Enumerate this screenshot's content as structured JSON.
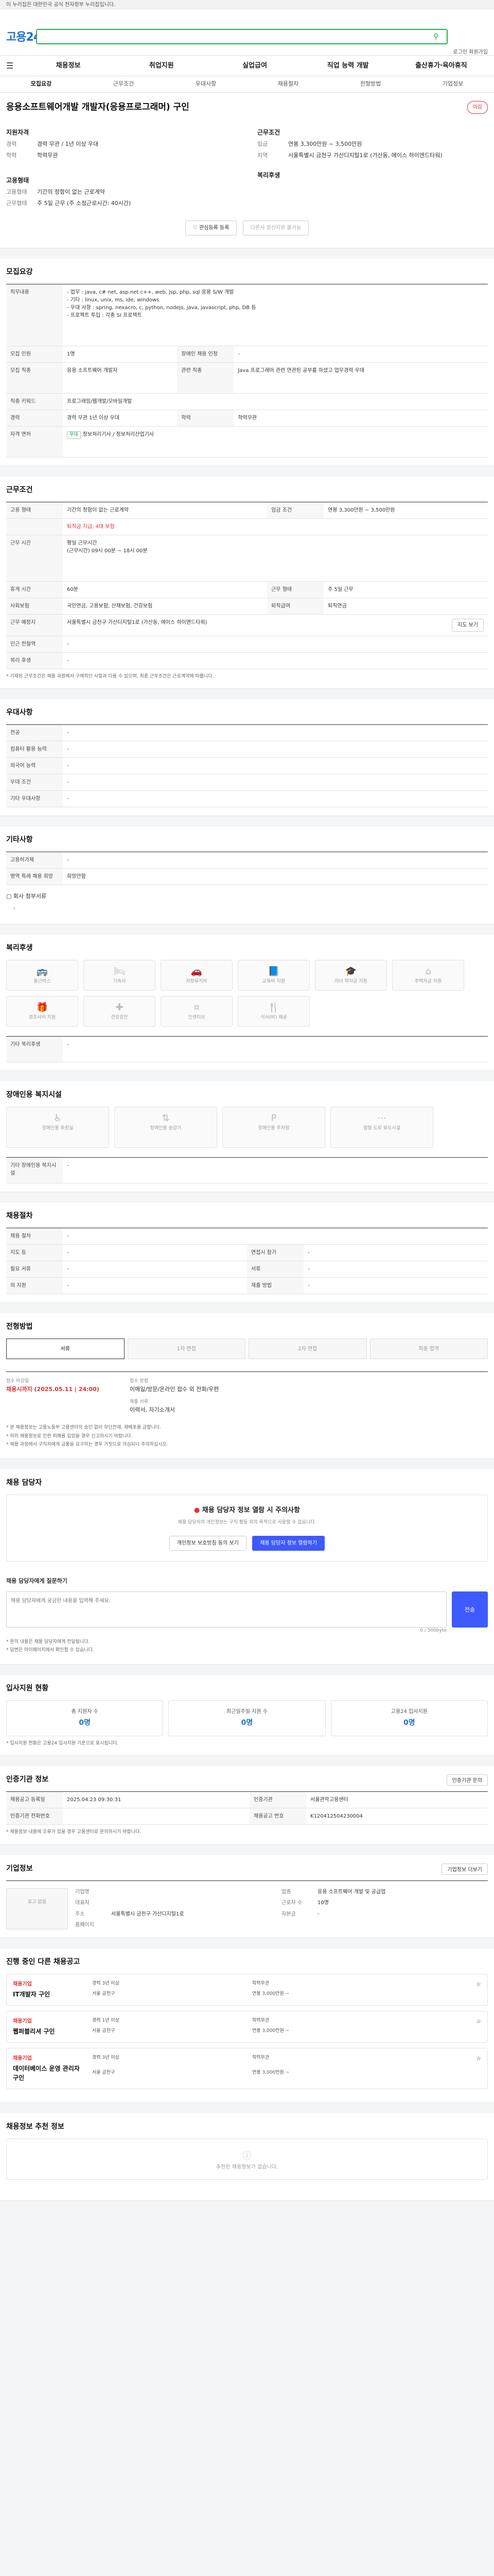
{
  "banner": {
    "text": "이 누리집은 대한민국 공식 전자정부 누리집입니다."
  },
  "header": {
    "logo": "고용24",
    "search_placeholder": "",
    "utils": "로그인 회원가입"
  },
  "nav": [
    "채용정보",
    "취업지원",
    "실업급여",
    "직업 능력 개발",
    "출산휴가·육아휴직"
  ],
  "tabs": [
    "모집요강",
    "근무조건",
    "우대사항",
    "채용절차",
    "전형방법",
    "기업정보"
  ],
  "job": {
    "title": "응용소프트웨어개발 개발자(응용프로그래머) 구인",
    "company": "",
    "badge": "마감",
    "left_title": "지원자격",
    "left_rows": [
      {
        "k": "경력",
        "v": "경력 무관 / 1년 이상 우대"
      },
      {
        "k": "학력",
        "v": "학력무관"
      }
    ],
    "left_title2": "고용형태",
    "left_rows2": [
      {
        "k": "고용형태",
        "v": "기간의 정함이 없는 근로계약"
      },
      {
        "k": "근무형태",
        "v": "주 5일 근무 (주 소정근로시간: 40시간)"
      }
    ],
    "right_title": "근무조건",
    "right_rows": [
      {
        "k": "임금",
        "v": "연봉 3,300만원 ~ 3,500만원"
      },
      {
        "k": "지역",
        "v": "서울특별시 금천구 가산디지털1로 (가산동, 에이스 하이엔드타워)"
      }
    ],
    "right_title2": "복리후생",
    "btn_scrap": "관심등록 등록",
    "btn_apply": "다른사 알선지원 불가능"
  },
  "recruit": {
    "head": "모집요강",
    "duties_label": "직무내용",
    "duties": "- 업무 : java, c# net, asp.net c++, web, jsp, php, sql 응용 S/W 개발\n- 기타 : linux, unix, ms, ide, windows\n- 우대 사항 : spring, nexacro, c, python, nodejs, java, javascript, php, DB 등\n- 프로젝트 투입 : 각종 SI 프로젝트",
    "rows": [
      {
        "k": "모집 인원",
        "v": "1명",
        "k2": "장애인 채용 인정",
        "v2": "-"
      },
      {
        "k": "모집 직종",
        "v": "응용 소프트웨어 개발자",
        "k2": "관련 직종",
        "v2": "Java 프로그래머 관련 연관된 공부를 하셨고 업무경력 우대"
      },
      {
        "k": "직종 키워드",
        "v": "프로그래밍/웹개발/모바일개발",
        "k2": "",
        "v2": ""
      },
      {
        "k": "경력",
        "v": "경력 무관 1년 이상 우대",
        "k2": "학력",
        "v2": "학력무관"
      },
      {
        "k": "자격 면허",
        "v": "정보처리기사 / 정보처리산업기사",
        "k2": "",
        "v2": ""
      }
    ]
  },
  "work": {
    "head": "근무조건",
    "rows": [
      {
        "k": "고용 형태",
        "v": "기간의 정함이 없는 근로계약",
        "k2": "임금 조건",
        "v2": "연봉 3,300만원 ~ 3,500만원"
      },
      {
        "k": "",
        "v": "퇴직금 지급, 4대 보험",
        "k2": "",
        "v2": ""
      },
      {
        "k": "근무 시간",
        "v": "평일 근무시간\n(근무시간) 09시 00분 ~ 18시 00분",
        "k2": "",
        "v2": ""
      },
      {
        "k": "휴게 시간",
        "v": "60분",
        "k2": "근무 형태",
        "v2": "주 5일 근무"
      },
      {
        "k": "사회보험",
        "v": "국민연금, 고용보험, 산재보험, 건강보험",
        "k2": "퇴직급여",
        "v2": "퇴직연금"
      },
      {
        "k": "근무 예정지",
        "v": "서울특별시 금천구 가산디지털1로 (가산동, 에이스 하이엔드타워)",
        "k2": "",
        "v2": ""
      },
      {
        "k": "인근 전철역",
        "v": "-",
        "k2": "",
        "v2": ""
      },
      {
        "k": "복리 후생",
        "v": "-",
        "k2": "",
        "v2": ""
      }
    ],
    "map_btn": "지도 보기",
    "note": "* 기재된 근무조건은 채용 과정에서 구체적인 사항과 다를 수 있으며, 최종 근무조건은 근로계약에 따릅니다."
  },
  "prefer": {
    "head": "우대사항",
    "rows": [
      {
        "k": "전공",
        "v": "-"
      },
      {
        "k": "컴퓨터 활용 능력",
        "v": "-"
      },
      {
        "k": "외국어 능력",
        "v": "-"
      },
      {
        "k": "우대 조건",
        "v": "-"
      },
      {
        "k": "기타 우대사항",
        "v": "-"
      }
    ]
  },
  "etc": {
    "head": "기타사항",
    "rows": [
      {
        "k": "고용허가제",
        "v": "-"
      },
      {
        "k": "병역 특례 채용 희망",
        "v": "희망안함"
      }
    ],
    "attach_label": "회사 첨부서류",
    "attach": "-"
  },
  "welfare": {
    "head": "복리후생",
    "items": [
      "통근버스",
      "기숙사",
      "차량유지비",
      "교육비 지원",
      "자녀 학자금 지원",
      "주택자금 지원",
      "경조사비 지원",
      "건강검진",
      "인센티브",
      "식사(비) 제공"
    ],
    "other_label": "기타 복리후생",
    "other": "-"
  },
  "disability": {
    "head": "장애인용 복지시설",
    "items": [
      "장애인용 화장실",
      "장애인용 승강기",
      "장애인용 주차장",
      "점형 도로 유도시설"
    ],
    "other_label": "기타 장애인용 복지시설",
    "other": "-"
  },
  "process": {
    "head": "채용절차",
    "rows": [
      {
        "k": "채용 절차",
        "v": "-",
        "k2": "",
        "v2": ""
      },
      {
        "k": "지도 등",
        "v": "-",
        "k2": "면접시 참가",
        "v2": "-"
      },
      {
        "k": "필요 서류",
        "v": "-",
        "k2": "서류",
        "v2": "-"
      },
      {
        "k": "외 지원",
        "v": "-",
        "k2": "제출 방법",
        "v2": "-"
      }
    ]
  },
  "selection": {
    "head": "전형방법",
    "steps": [
      "서류",
      "1차 면접",
      "2차 면접",
      "최종 합격"
    ],
    "left_label": "접수 마감일",
    "left_value": "채용시까지 (2025.05.11 | 24:00)",
    "mid_label": "접수 방법",
    "mid_value": "이메일/방문/온라인 접수 외 전화/우편",
    "mid_label2": "제출 서류",
    "mid_value2": "이력서, 자기소개서",
    "notes": [
      "* 본 채용정보는 고용노동부 고용센터의 승인 없이 무단전재, 재배포를 금합니다.",
      "* 허위 채용정보로 인한 피해를 입었을 경우 신고하시기 바랍니다.",
      "* 채용 과정에서 구직자에게 금품을 요구하는 경우 거짓으로 의심되니 주의하십시오."
    ]
  },
  "contact": {
    "head": "채용 담당자",
    "title": "채용 담당자 정보 열람 시 주의사항",
    "desc": "채용 담당자의 개인정보는 구직 활동 외의 목적으로 사용할 수 없습니다.",
    "btn_view": "개인정보 보호방침 동의 보기",
    "btn_open": "채용 담당자 정보 열람하기",
    "qa_title": "채용 담당자에게 질문하기",
    "qa_placeholder": "채용 담당자에게 궁금한 내용을 입력해 주세요.",
    "qa_count": "0 / 500byte",
    "qa_send": "전송",
    "qa_notes": [
      "* 문의 내용은 채용 담당자에게 전달됩니다.",
      "* 답변은 마이페이지에서 확인할 수 있습니다."
    ]
  },
  "stats": {
    "head": "입사지원 현황",
    "cards": [
      {
        "t": "총 지원자 수",
        "v": "0명"
      },
      {
        "t": "최근일주일 지원 수",
        "v": "0명"
      },
      {
        "t": "고용24 입사지원",
        "v": "0명"
      }
    ],
    "note": "* 입사지원 현황은 고용24 입사지원 기준으로 표시됩니다."
  },
  "regist": {
    "head": "인증기관 정보",
    "rows": [
      {
        "k": "채용공고 등록일",
        "v": "2025.04.23 09:30:31",
        "k2": "인증기관",
        "v2": "서울관악고용센터"
      },
      {
        "k": "인증기관 전화번호",
        "v": "",
        "k2": "채용공고 번호",
        "v2": "K120412504230004"
      }
    ],
    "note": "* 채용정보 내용에 오류가 있을 경우 고용센터로 문의하시기 바랍니다.",
    "btn": "인증기관 문의"
  },
  "company_info": {
    "head": "기업정보",
    "logo": "로고 없음",
    "rows": [
      {
        "k": "기업명",
        "v": "",
        "k2": "업종",
        "v2": "응용 소프트웨어 개발 및 공급업"
      },
      {
        "k": "대표자",
        "v": "",
        "k2": "근로자 수",
        "v2": "10명"
      },
      {
        "k": "주소",
        "v": "서울특별시 금천구 가산디지털1로",
        "k2": "자본금",
        "v2": "-"
      },
      {
        "k": "홈페이지",
        "v": "",
        "k2": "",
        "v2": ""
      }
    ],
    "btn": "기업정보 더보기"
  },
  "other_jobs": {
    "head": "진행 중인 다른 채용공고",
    "jobs": [
      {
        "co": "채용기업",
        "title": "IT개발자 구인",
        "a": "경력 3년 이상",
        "b": "학력무관",
        "c": "서울 금천구",
        "d": "연봉 3,000만원 ~"
      },
      {
        "co": "채용기업",
        "title": "웹퍼블리셔 구인",
        "a": "경력 1년 이상",
        "b": "학력무관",
        "c": "서울 금천구",
        "d": "연봉 3,000만원 ~"
      },
      {
        "co": "채용기업",
        "title": "데이터베이스 운영 관리자 구인",
        "a": "경력 3년 이상",
        "b": "학력무관",
        "c": "서울 금천구",
        "d": "연봉 3,000만원 ~"
      }
    ]
  },
  "recommend": {
    "head": "채용정보 추천 정보",
    "empty": "추천된 채용정보가 없습니다."
  }
}
